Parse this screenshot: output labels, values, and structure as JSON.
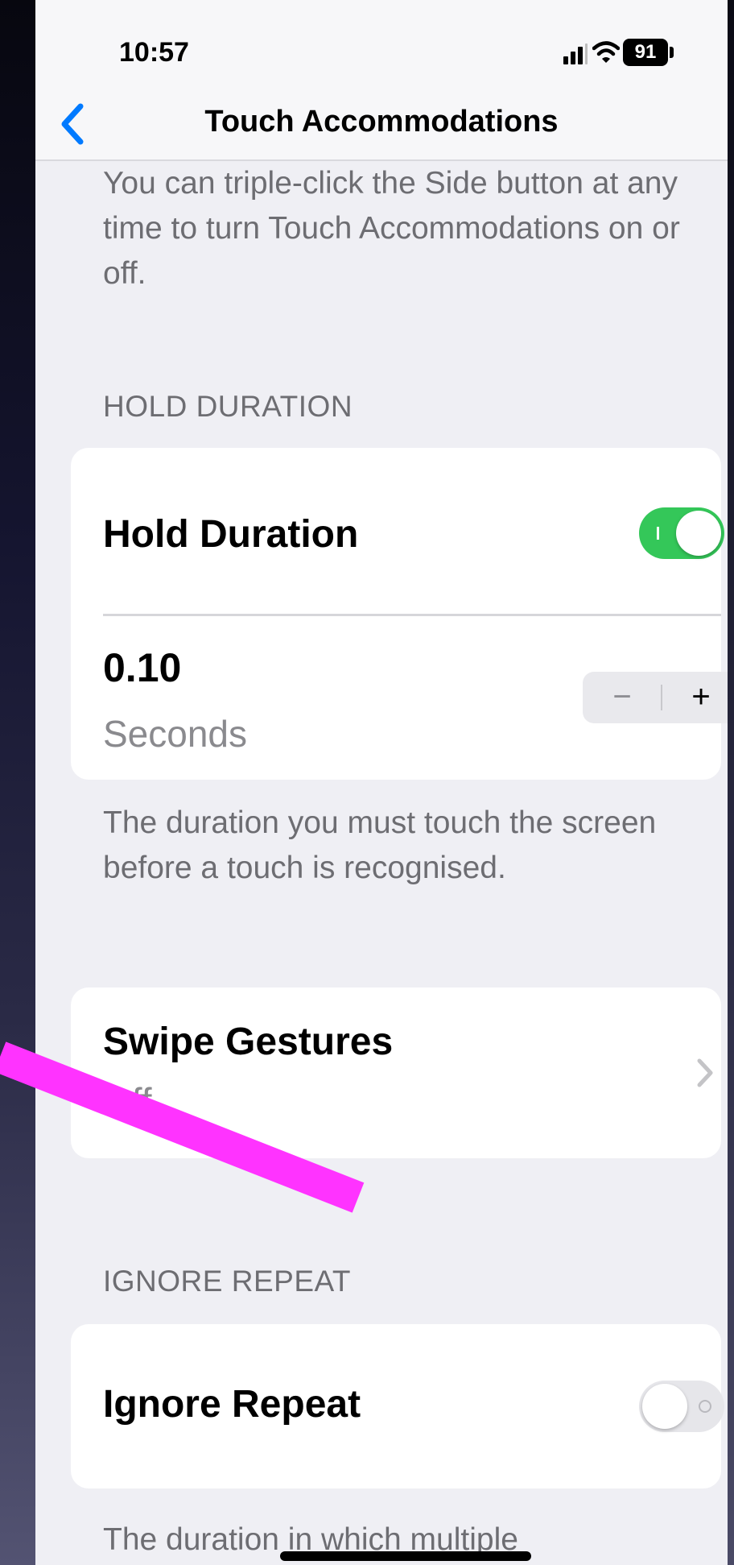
{
  "status_bar": {
    "time": "10:57",
    "battery": "91"
  },
  "nav": {
    "back_icon": "chevron-left-icon",
    "title": "Touch Accommodations"
  },
  "intro_text": "You can triple-click the Side button at any time to turn Touch Accommodations on or off.",
  "hold_duration": {
    "header": "HOLD DURATION",
    "toggle_label": "Hold Duration",
    "toggle_on": true,
    "value": "0.10",
    "unit": "Seconds",
    "stepper_minus": "−",
    "stepper_plus": "+",
    "footer": "The duration you must touch the screen before a touch is recognised."
  },
  "swipe_gestures": {
    "label": "Swipe Gestures",
    "value": "Off"
  },
  "ignore_repeat": {
    "header": "IGNORE REPEAT",
    "toggle_label": "Ignore Repeat",
    "toggle_on": false,
    "footer": "The duration in which multiple"
  },
  "colors": {
    "accent": "#007aff",
    "toggle_on": "#34c759",
    "annotation": "#ff33ff"
  }
}
